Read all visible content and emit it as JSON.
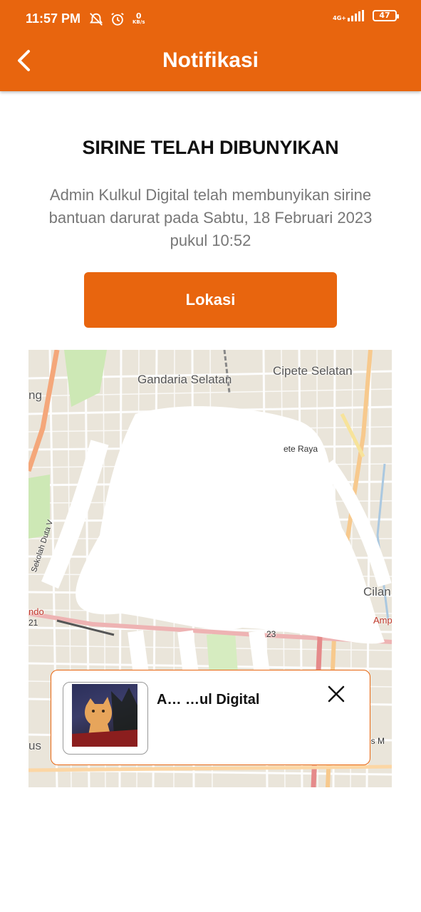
{
  "status_bar": {
    "time": "11:57 PM",
    "net_speed_value": "0",
    "net_speed_unit": "KB/s",
    "network_type": "4G+",
    "battery": "47"
  },
  "app_bar": {
    "title": "Notifikasi",
    "back_icon": "chevron-left-icon"
  },
  "notification": {
    "heading": "SIRINE TELAH DIBUNYIKAN",
    "message": "Admin Kulkul Digital telah membunyikan sirine bantuan darurat pada Sabtu, 18 Februari 2023 pukul 10:52",
    "location_button": "Lokasi"
  },
  "map": {
    "labels": [
      "Gandaria Selatan",
      "Cipete Selatan",
      "ng",
      "ete Raya",
      "Cilan",
      "Amp",
      "Sekolah Duta V",
      "ndo",
      "21",
      "23",
      "us",
      "os M"
    ]
  },
  "popup": {
    "sender_name": "A… …ul Digital",
    "close_icon": "close-icon"
  },
  "colors": {
    "brand": "#E8650E",
    "text_muted": "#777777"
  }
}
